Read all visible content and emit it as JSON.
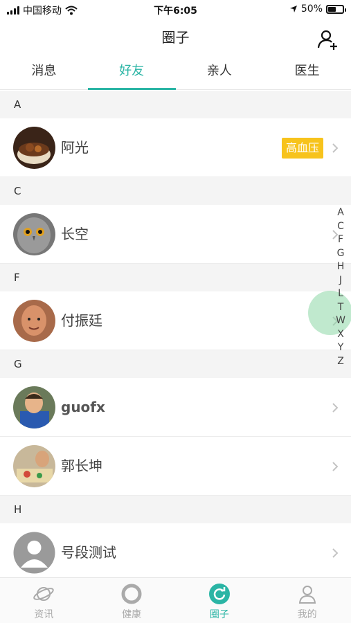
{
  "status_bar": {
    "carrier": "中国移动",
    "time": "下午6:05",
    "battery": "50%",
    "battery_level": 0.5
  },
  "nav": {
    "title": "圈子"
  },
  "tabs": [
    {
      "label": "消息",
      "active": false
    },
    {
      "label": "好友",
      "active": true
    },
    {
      "label": "亲人",
      "active": false
    },
    {
      "label": "医生",
      "active": false
    }
  ],
  "sections": [
    {
      "letter": "A",
      "contacts": [
        {
          "name": "阿光",
          "tag": "高血压"
        }
      ]
    },
    {
      "letter": "C",
      "contacts": [
        {
          "name": "长空"
        }
      ]
    },
    {
      "letter": "F",
      "contacts": [
        {
          "name": "付振廷"
        }
      ]
    },
    {
      "letter": "G",
      "contacts": [
        {
          "name": "guofx"
        },
        {
          "name": "郭长坤"
        }
      ]
    },
    {
      "letter": "H",
      "contacts": [
        {
          "name": "号段测试"
        }
      ]
    }
  ],
  "index_letters": [
    "A",
    "C",
    "F",
    "G",
    "H",
    "J",
    "L",
    "T",
    "W",
    "X",
    "Y",
    "Z"
  ],
  "bottom_tabs": [
    {
      "label": "资讯",
      "icon": "planet-icon"
    },
    {
      "label": "健康",
      "icon": "ring-icon"
    },
    {
      "label": "圈子",
      "icon": "refresh-circle-icon"
    },
    {
      "label": "我的",
      "icon": "person-icon"
    }
  ],
  "colors": {
    "accent": "#2bb5a5",
    "tag_bg": "#f7c31c"
  }
}
